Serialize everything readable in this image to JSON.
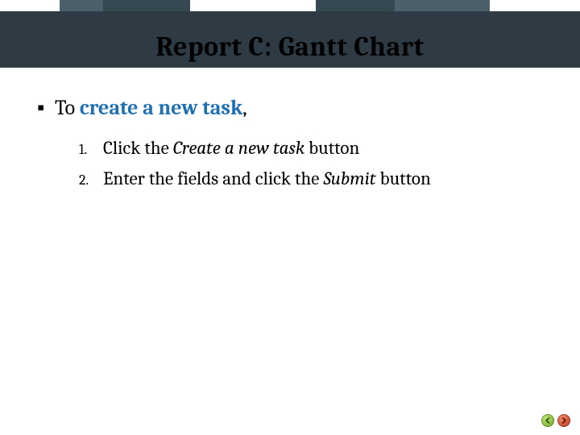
{
  "title": "Report C: Gantt Chart",
  "intro": {
    "prefix": "To ",
    "link": "create a new task",
    "suffix": ","
  },
  "steps": [
    {
      "num": "1.",
      "before": "Click the ",
      "em": "Create a new task",
      "after": " button"
    },
    {
      "num": "2.",
      "before": "Enter the fields and click the ",
      "em": "Submit",
      "after": " button"
    }
  ],
  "nav": {
    "back": "back",
    "forward": "forward"
  }
}
